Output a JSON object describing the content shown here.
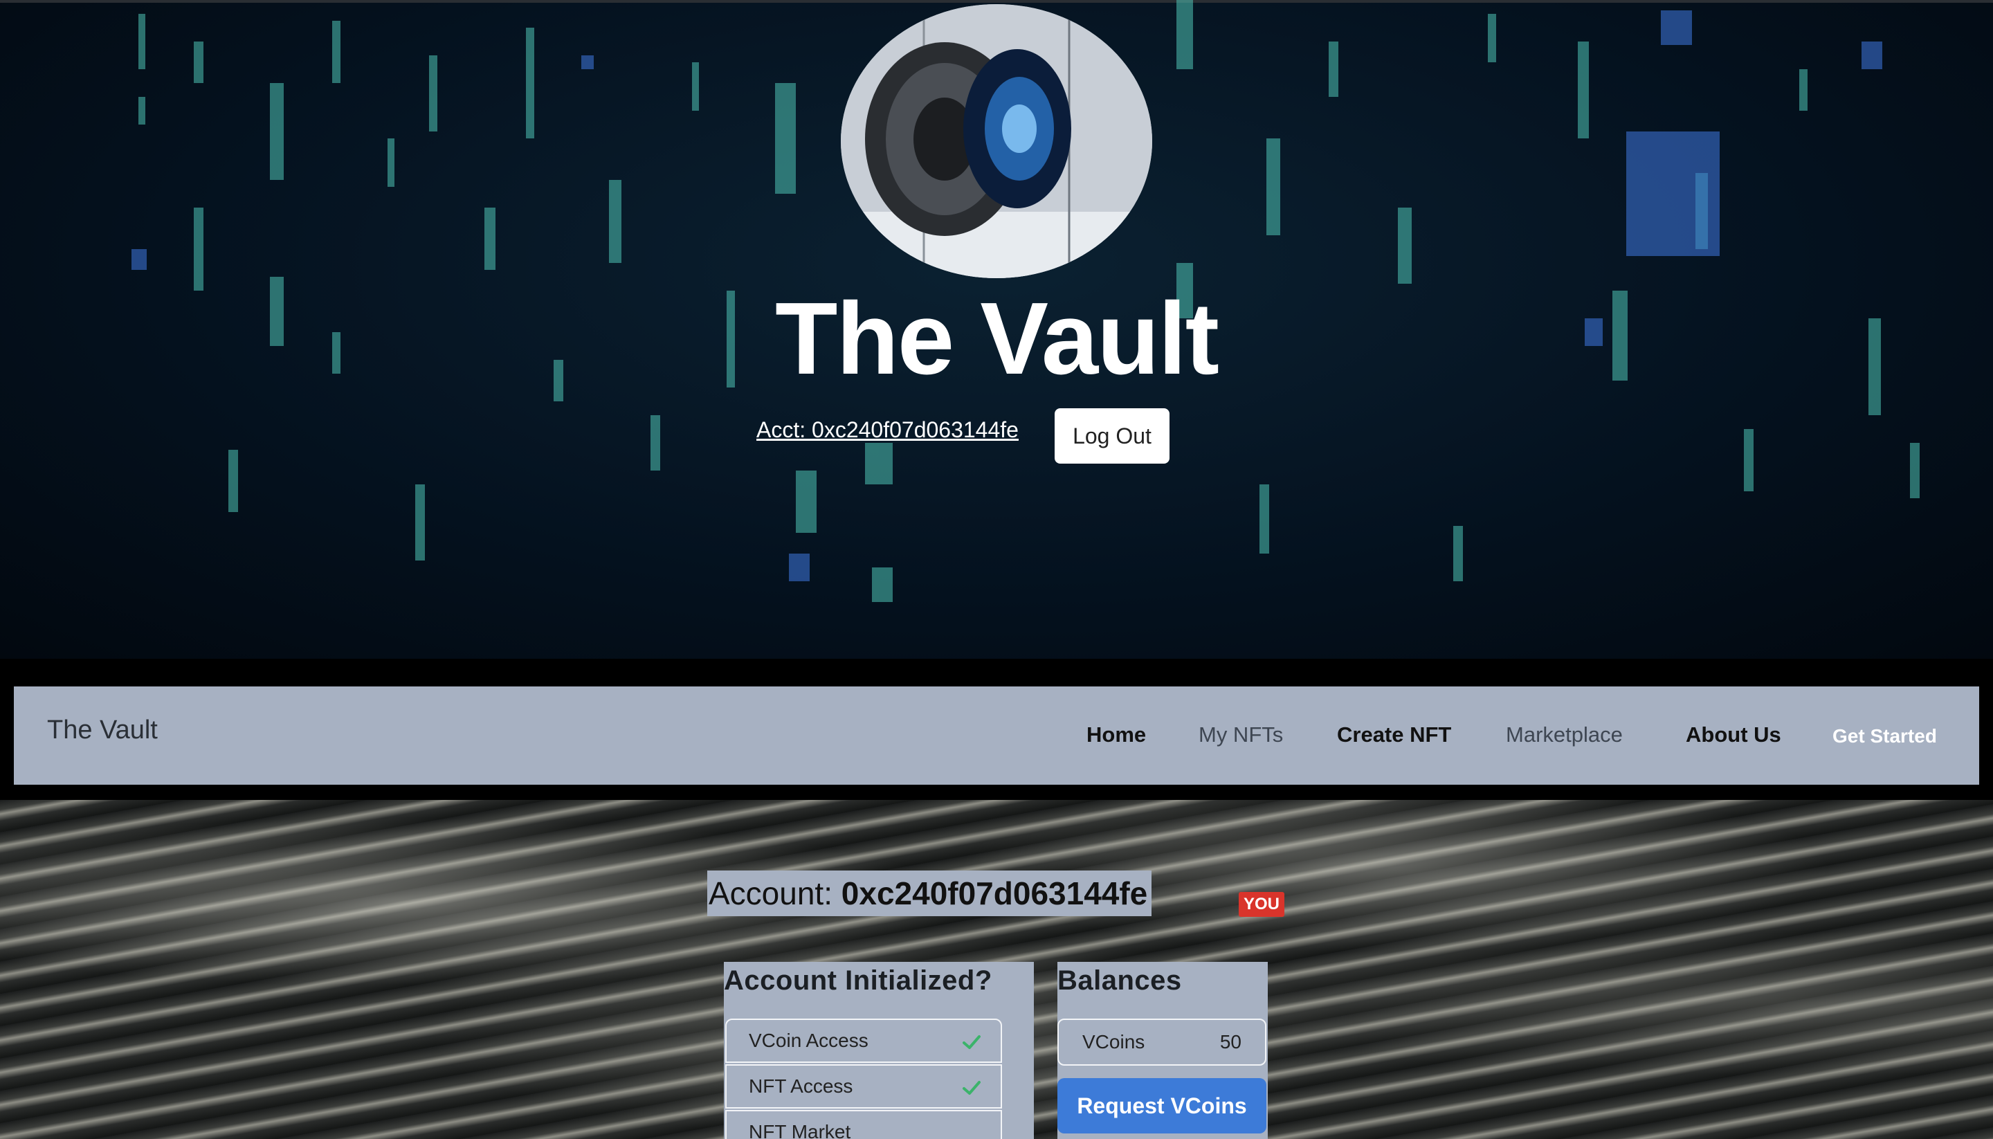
{
  "hero": {
    "title": "The Vault",
    "account_link": "Acct: 0xc240f07d063144fe",
    "logout_label": "Log Out"
  },
  "navbar": {
    "brand": "The Vault",
    "items": [
      {
        "label": "Home"
      },
      {
        "label": "My NFTs"
      },
      {
        "label": "Create NFT"
      },
      {
        "label": "Marketplace"
      },
      {
        "label": "About Us"
      },
      {
        "label": "Get Started"
      }
    ]
  },
  "account": {
    "prefix": "Account:",
    "address": "0xc240f07d063144fe",
    "badge": "YOU"
  },
  "initialized": {
    "title": "Account Initialized?",
    "items": [
      {
        "label": "VCoin Access",
        "status": "check"
      },
      {
        "label": "NFT Access",
        "status": "check"
      },
      {
        "label": "NFT Market"
      }
    ]
  },
  "balances": {
    "title": "Balances",
    "vcoins_label": "VCoins",
    "vcoins_value": "50",
    "request_label": "Request VCoins"
  },
  "colors": {
    "accent": "#3d7bd8",
    "badge": "#d9342b",
    "panel": "#a7b1c2",
    "check": "#3bb36a"
  }
}
